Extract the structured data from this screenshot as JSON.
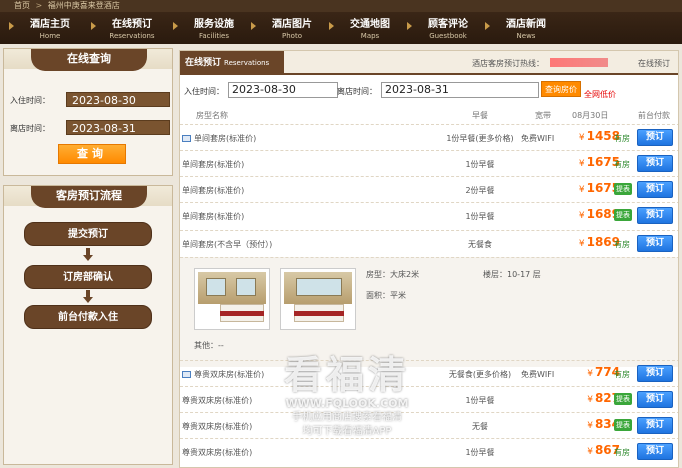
{
  "breadcrumb": {
    "home": "首页",
    "separator": ">",
    "current": "福州中庚喜来登酒店"
  },
  "nav": [
    {
      "zh": "酒店主页",
      "en": "Home"
    },
    {
      "zh": "在线预订",
      "en": "Reservations"
    },
    {
      "zh": "服务设施",
      "en": "Facilities"
    },
    {
      "zh": "酒店图片",
      "en": "Photo"
    },
    {
      "zh": "交通地图",
      "en": "Maps"
    },
    {
      "zh": "顾客评论",
      "en": "Guestbook"
    },
    {
      "zh": "酒店新闻",
      "en": "News"
    }
  ],
  "sidebar": {
    "search": {
      "title": "在线查询",
      "checkin_label": "入住时间：",
      "checkin_value": "2023-08-30",
      "checkout_label": "离店时间：",
      "checkout_value": "2023-08-31",
      "query_button": "查询"
    },
    "flow": {
      "title": "客房预订流程",
      "steps": [
        "提交预订",
        "订房部确认",
        "前台付款入住"
      ]
    }
  },
  "main": {
    "tab_zh": "在线预订",
    "tab_en": "Reservations",
    "hotline_label": "酒店客房预订热线：",
    "online_booking": "在线预订",
    "checkin_label": "入住时间：",
    "checkin_value": "2023-08-30",
    "checkout_label": "离店时间：",
    "checkout_value": "2023-08-31",
    "query_room_button": "查询房价",
    "all_price_link": "全网低价",
    "columns": {
      "room": "房型名称",
      "meal": "早餐",
      "broadband": "宽带",
      "date": "08月30日",
      "pay": "前台付款"
    },
    "rows": [
      {
        "name": "单间套房(标准价)",
        "has_pic": true,
        "meal": "1份早餐(更多价格)",
        "wifi": "免费WIFI",
        "currency": "¥",
        "price": "1458",
        "avail": "有房",
        "avail_badge": false,
        "book": "预订"
      },
      {
        "name": "单间套房(标准价)",
        "has_pic": false,
        "meal": "1份早餐",
        "wifi": "",
        "currency": "¥",
        "price": "1675",
        "avail": "有房",
        "avail_badge": false,
        "book": "预订"
      },
      {
        "name": "单间套房(标准价)",
        "has_pic": false,
        "meal": "2份早餐",
        "wifi": "",
        "currency": "¥",
        "price": "1675",
        "avail": "提表",
        "avail_badge": true,
        "book": "预订"
      },
      {
        "name": "单间套房(标准价)",
        "has_pic": false,
        "meal": "1份早餐",
        "wifi": "",
        "currency": "¥",
        "price": "1689",
        "avail": "提表",
        "avail_badge": true,
        "book": "预订"
      },
      {
        "name": "单间套房(不含早（预付）)",
        "has_pic": false,
        "meal": "无餐食",
        "wifi": "",
        "currency": "¥",
        "price": "1869",
        "avail": "有房",
        "avail_badge": false,
        "book": "预订"
      }
    ],
    "detail": {
      "room_type_label": "房型：",
      "room_type_value": "大床2米",
      "floor_label": "楼层：",
      "floor_value": "10-17 层",
      "area_label": "面积：",
      "area_value": "平米",
      "other_label": "其他：",
      "other_value": "--"
    },
    "rows2": [
      {
        "name": "尊贵双床房(标准价)",
        "has_pic": true,
        "meal": "无餐食(更多价格)",
        "wifi": "免费WIFI",
        "currency": "¥",
        "price": "774",
        "avail": "有房",
        "avail_badge": false,
        "book": "预订"
      },
      {
        "name": "尊贵双床房(标准价)",
        "has_pic": false,
        "meal": "1份早餐",
        "wifi": "",
        "currency": "¥",
        "price": "827",
        "avail": "提表",
        "avail_badge": true,
        "book": "预订"
      },
      {
        "name": "尊贵双床房(标准价)",
        "has_pic": false,
        "meal": "无餐",
        "wifi": "",
        "currency": "¥",
        "price": "834",
        "avail": "提表",
        "avail_badge": true,
        "book": "预订"
      },
      {
        "name": "尊贵双床房(标准价)",
        "has_pic": false,
        "meal": "1份早餐",
        "wifi": "",
        "currency": "¥",
        "price": "867",
        "avail": "有房",
        "avail_badge": false,
        "book": "预订"
      }
    ]
  },
  "watermark": {
    "big": "看福清",
    "url": "WWW.FQLOOK.COM",
    "line1": "手机应用商店搜索看福清",
    "line2": "均可下载看福清APP"
  }
}
